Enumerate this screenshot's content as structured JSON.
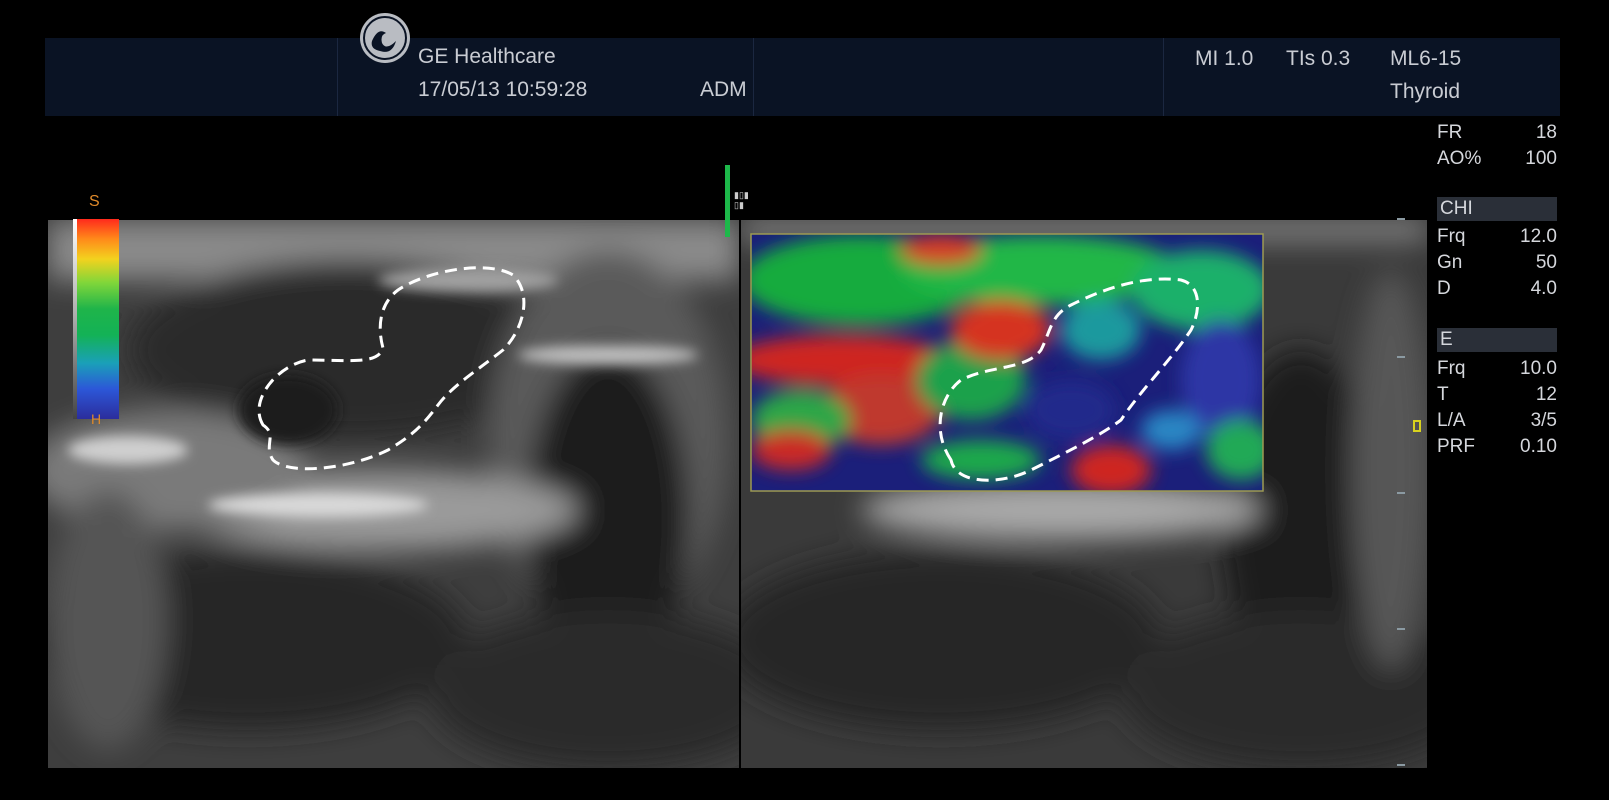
{
  "header": {
    "brand": "GE Healthcare",
    "datetime": "17/05/13 10:59:28",
    "operator": "ADM",
    "mi": "MI 1.0",
    "tis": "TIs 0.3",
    "probe": "ML6-15",
    "preset": "Thyroid"
  },
  "params": {
    "fr_label": "FR",
    "fr_value": "18",
    "ao_label": "AO%",
    "ao_value": "100",
    "chi_header": "CHI",
    "chi_frq_label": "Frq",
    "chi_frq_value": "12.0",
    "chi_gn_label": "Gn",
    "chi_gn_value": "50",
    "chi_d_label": "D",
    "chi_d_value": "4.0",
    "e_header": "E",
    "e_frq_label": "Frq",
    "e_frq_value": "10.0",
    "e_t_label": "T",
    "e_t_value": "12",
    "e_la_label": "L/A",
    "e_la_value": "3/5",
    "e_prf_label": "PRF",
    "e_prf_value": "0.10"
  },
  "scale": {
    "top_label": "S",
    "bottom_label": "H"
  },
  "colors": {
    "header_bg": "#0a1324",
    "roi_border": "#9d9a52",
    "indicator": "#1db84a"
  }
}
